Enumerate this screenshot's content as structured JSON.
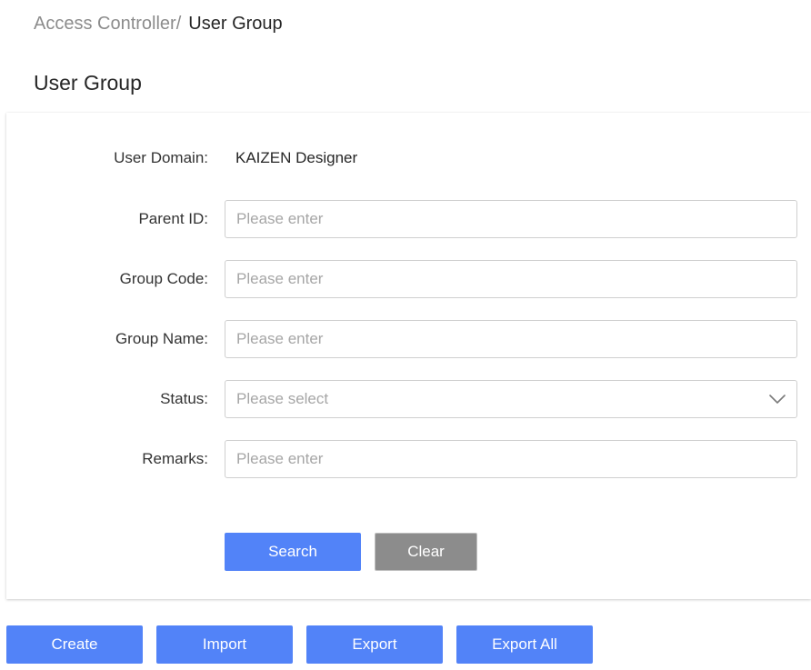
{
  "breadcrumb": {
    "parent": "Access Controller/",
    "current": "User Group"
  },
  "page_title": "User Group",
  "form": {
    "user_domain": {
      "label": "User Domain:",
      "value": "KAIZEN Designer"
    },
    "parent_id": {
      "label": "Parent ID:",
      "placeholder": "Please enter",
      "value": ""
    },
    "group_code": {
      "label": "Group Code:",
      "placeholder": "Please enter",
      "value": ""
    },
    "group_name": {
      "label": "Group Name:",
      "placeholder": "Please enter",
      "value": ""
    },
    "status": {
      "label": "Status:",
      "placeholder": "Please select",
      "icon": "chevron-down-icon"
    },
    "remarks": {
      "label": "Remarks:",
      "placeholder": "Please enter",
      "value": ""
    },
    "search_label": "Search",
    "clear_label": "Clear"
  },
  "actions": {
    "create_label": "Create",
    "import_label": "Import",
    "export_label": "Export",
    "export_all_label": "Export All"
  },
  "colors": {
    "primary": "#5283f8",
    "secondary": "#8c8c8c",
    "border": "#cfcfcf",
    "placeholder": "#a6a6a6"
  }
}
